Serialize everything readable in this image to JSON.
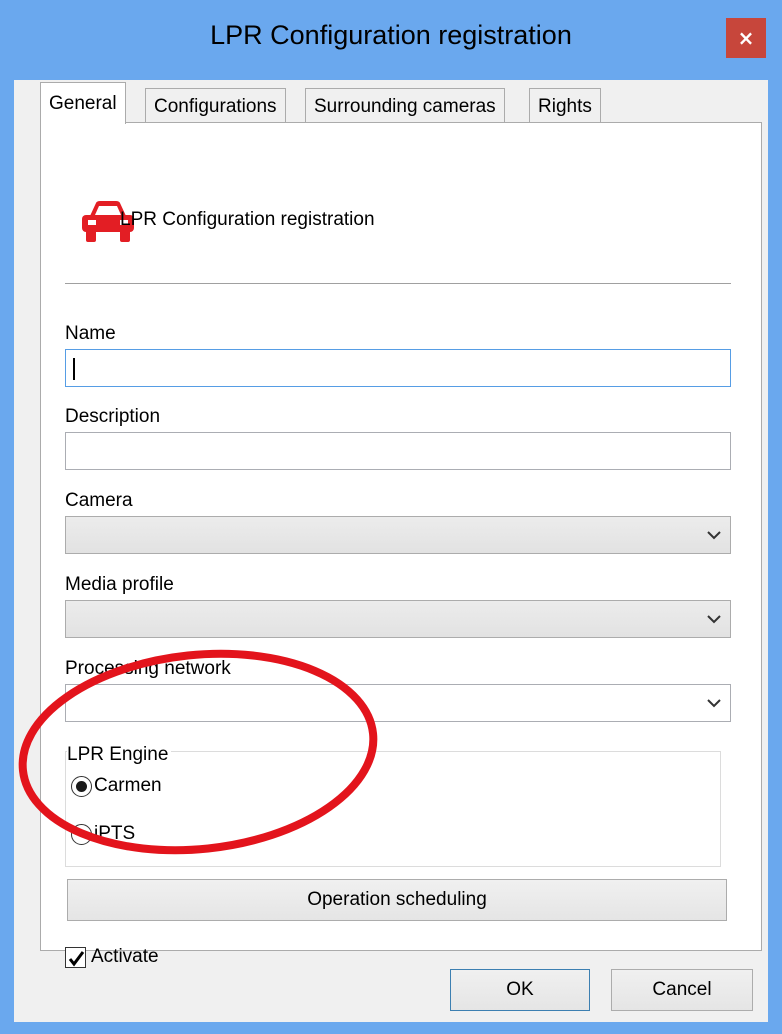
{
  "window": {
    "title": "LPR Configuration registration",
    "close_glyph": "×"
  },
  "tabs": [
    {
      "label": "General",
      "active": true
    },
    {
      "label": "Configurations",
      "active": false
    },
    {
      "label": "Surrounding cameras",
      "active": false
    },
    {
      "label": "Rights",
      "active": false
    }
  ],
  "header": {
    "icon": "car-icon",
    "icon_color": "#e31e24",
    "text": "LPR Configuration registration"
  },
  "fields": {
    "name": {
      "label": "Name",
      "value": ""
    },
    "description": {
      "label": "Description",
      "value": ""
    },
    "camera": {
      "label": "Camera",
      "value": ""
    },
    "media_profile": {
      "label": "Media profile",
      "value": ""
    },
    "processing_network": {
      "label": "Processing network",
      "value": ""
    }
  },
  "lpr_engine": {
    "label": "LPR Engine",
    "options": [
      {
        "label": "Carmen",
        "selected": true
      },
      {
        "label": "iPTS",
        "selected": false
      }
    ]
  },
  "operation_scheduling_label": "Operation scheduling",
  "activate": {
    "label": "Activate",
    "checked": true
  },
  "footer": {
    "ok_label": "OK",
    "cancel_label": "Cancel"
  },
  "colors": {
    "titlebar": "#6aa8ee",
    "close_button": "#c7463b",
    "annotation_ellipse": "#e3141c"
  }
}
